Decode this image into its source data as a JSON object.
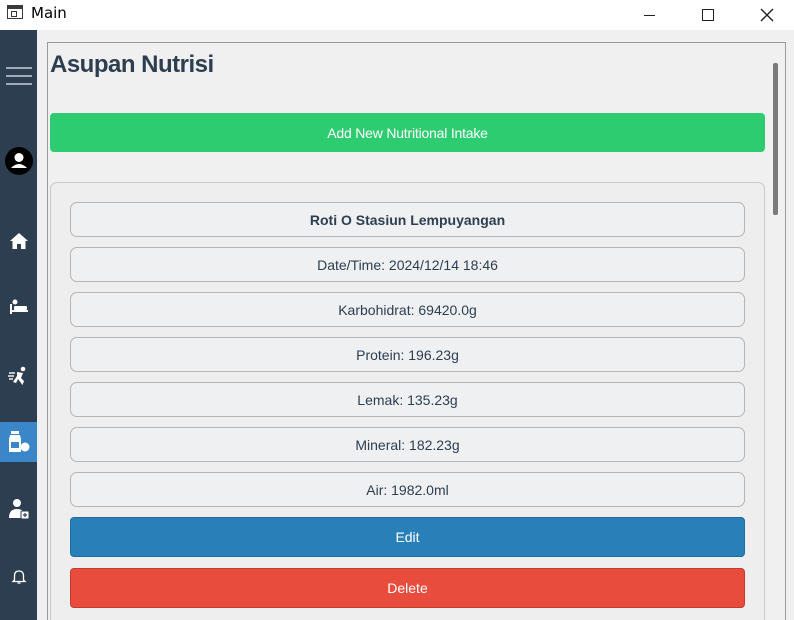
{
  "window": {
    "title": "Main"
  },
  "sidebar": {
    "items": [
      {
        "name": "menu-icon"
      },
      {
        "name": "profile-icon"
      },
      {
        "name": "home-icon"
      },
      {
        "name": "rest-icon"
      },
      {
        "name": "running-icon"
      },
      {
        "name": "nutrition-icon",
        "active": true
      },
      {
        "name": "doctor-icon"
      },
      {
        "name": "bell-icon"
      }
    ],
    "colors": {
      "background": "#2d3e50",
      "active": "#3b86c9"
    }
  },
  "page": {
    "title": "Asupan Nutrisi",
    "add_button": "Add New Nutritional Intake"
  },
  "entry": {
    "name": "Roti O Stasiun Lempuyangan",
    "datetime": "Date/Time: 2024/12/14 18:46",
    "karbohidrat": "Karbohidrat: 69420.0g",
    "protein": "Protein: 196.23g",
    "lemak": "Lemak: 135.23g",
    "mineral": "Mineral: 182.23g",
    "air": "Air: 1982.0ml",
    "edit_label": "Edit",
    "delete_label": "Delete"
  },
  "colors": {
    "add": "#2ecc71",
    "edit": "#2980b9",
    "delete": "#e74c3c",
    "title": "#2d3e50"
  }
}
